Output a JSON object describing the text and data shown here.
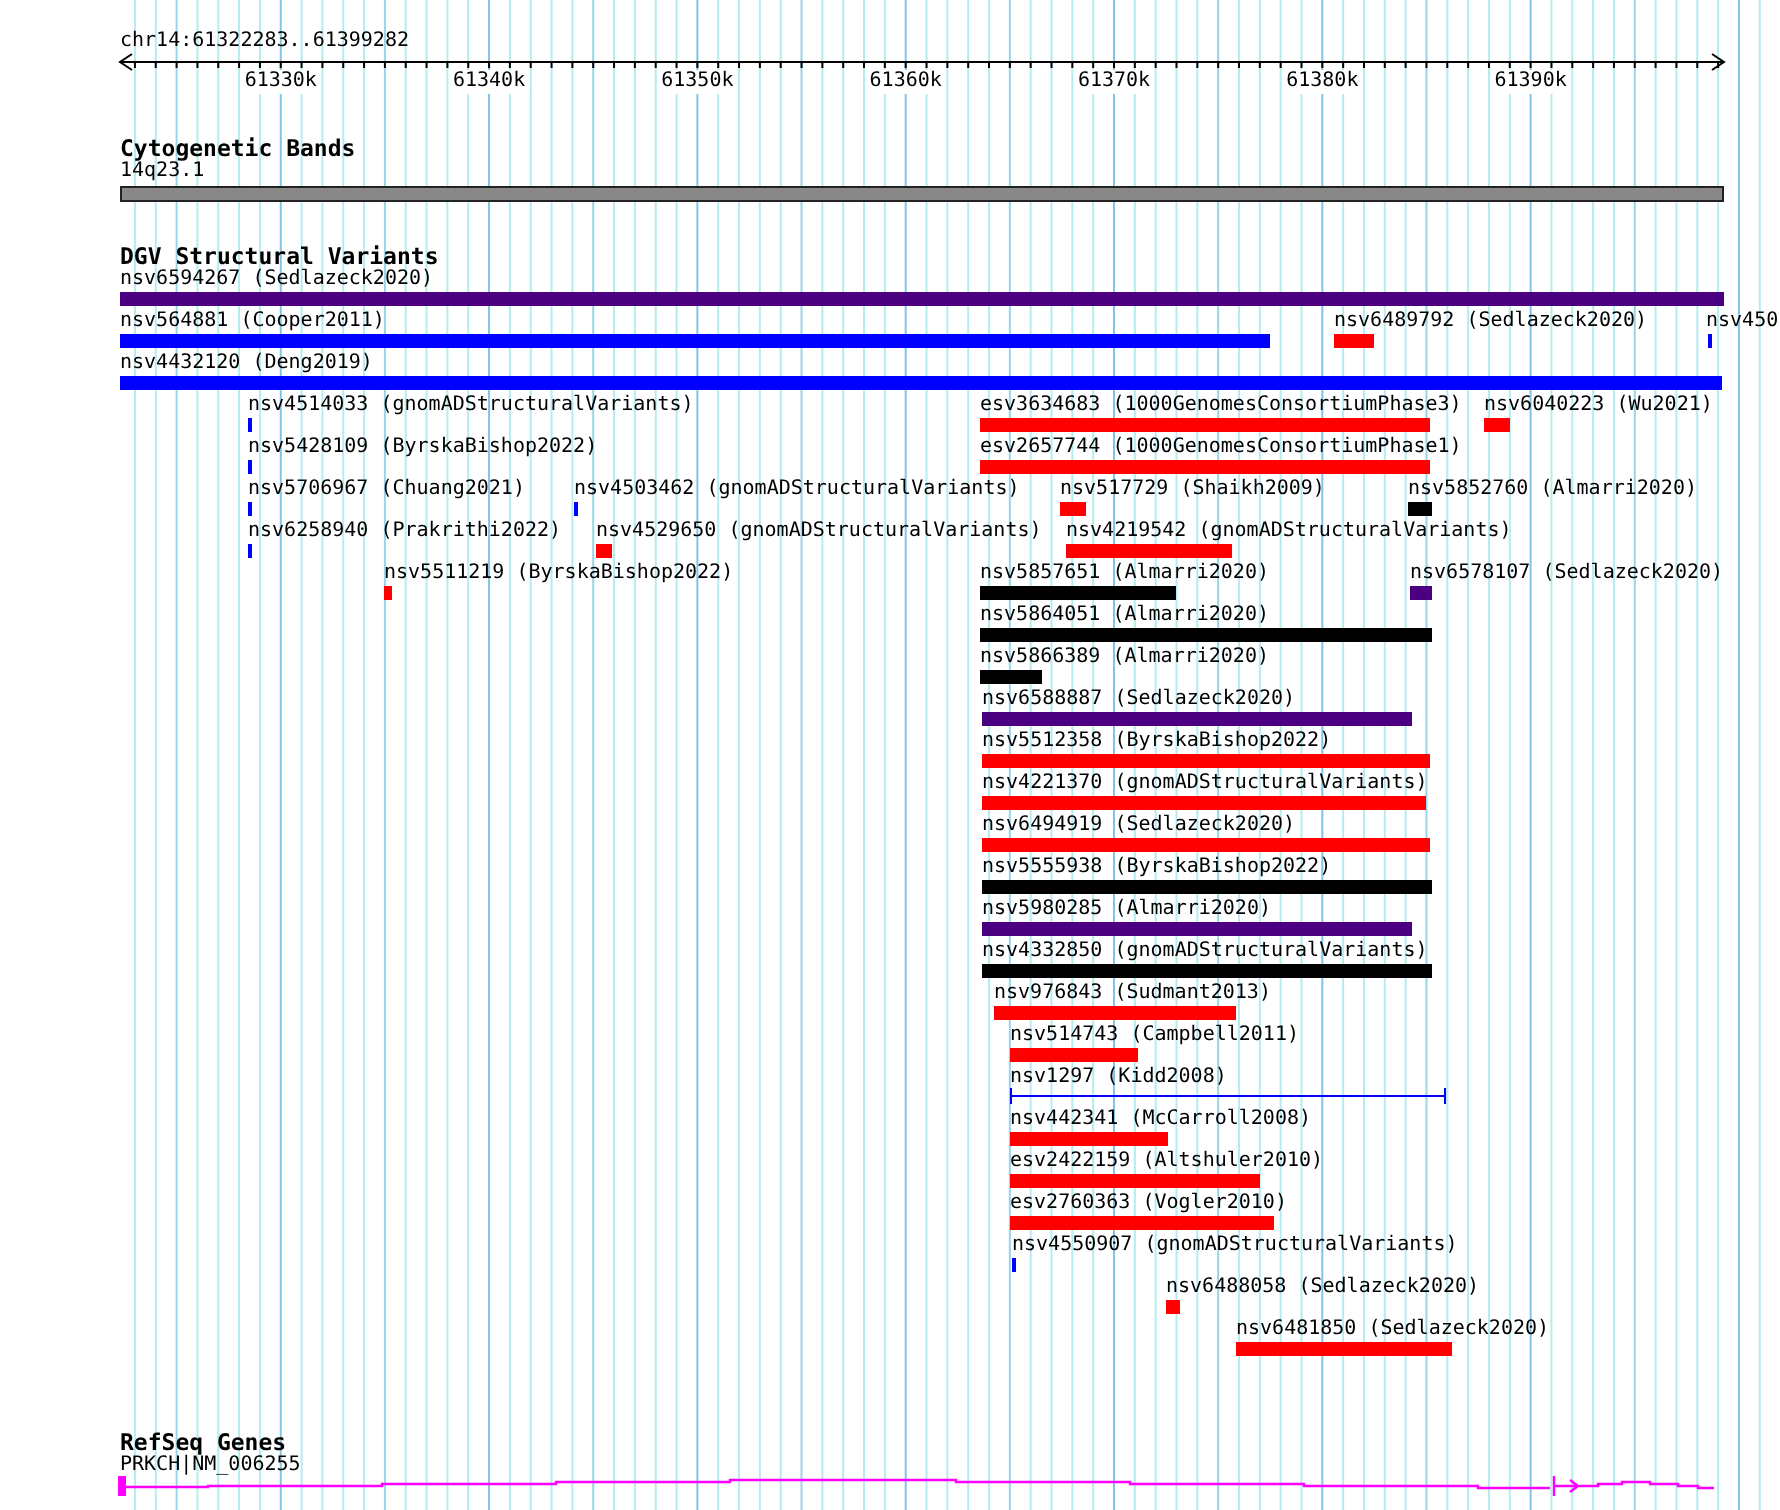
{
  "ruler": {
    "location": "chr14:61322283..61399282",
    "ticks": [
      "61330k",
      "61340k",
      "61350k",
      "61360k",
      "61370k",
      "61380k",
      "61390k"
    ]
  },
  "tracks": [
    {
      "kind": "cytoband",
      "title": "Cytogenetic Bands",
      "features": [
        {
          "label": "14q23.1"
        }
      ]
    },
    {
      "kind": "variants",
      "title": "DGV Structural Variants",
      "features": [
        {
          "label": "nsv6594267 (Sedlazeck2020)",
          "color": "#4b0082",
          "kind": "bar"
        },
        {
          "label": "nsv564881 (Cooper2011)",
          "color": "#0000ff",
          "kind": "bar"
        },
        {
          "label": "nsv6489792 (Sedlazeck2020)",
          "color": "#ff0000",
          "kind": "bar"
        },
        {
          "label": "nsv450",
          "color": "#0000ff",
          "kind": "bar"
        },
        {
          "label": "nsv4432120 (Deng2019)",
          "color": "#0000ff",
          "kind": "bar"
        },
        {
          "label": "nsv4514033 (gnomADStructuralVariants)",
          "color": "#0000ff",
          "kind": "bar"
        },
        {
          "label": "esv3634683 (1000GenomesConsortiumPhase3)",
          "color": "#ff0000",
          "kind": "bar"
        },
        {
          "label": "nsv6040223 (Wu2021)",
          "color": "#ff0000",
          "kind": "bar"
        },
        {
          "label": "nsv5428109 (ByrskaBishop2022)",
          "color": "#0000ff",
          "kind": "bar"
        },
        {
          "label": "esv2657744 (1000GenomesConsortiumPhase1)",
          "color": "#ff0000",
          "kind": "bar"
        },
        {
          "label": "nsv5706967 (Chuang2021)",
          "color": "#0000ff",
          "kind": "bar"
        },
        {
          "label": "nsv4503462 (gnomADStructuralVariants)",
          "color": "#0000ff",
          "kind": "bar"
        },
        {
          "label": "nsv517729 (Shaikh2009)",
          "color": "#ff0000",
          "kind": "bar"
        },
        {
          "label": "nsv5852760 (Almarri2020)",
          "color": "#000000",
          "kind": "bar"
        },
        {
          "label": "nsv6258940 (Prakrithi2022)",
          "color": "#0000ff",
          "kind": "bar"
        },
        {
          "label": "nsv4529650 (gnomADStructuralVariants)",
          "color": "#ff0000",
          "kind": "bar"
        },
        {
          "label": "nsv4219542 (gnomADStructuralVariants)",
          "color": "#ff0000",
          "kind": "bar"
        },
        {
          "label": "nsv5511219 (ByrskaBishop2022)",
          "color": "#ff0000",
          "kind": "bar"
        },
        {
          "label": "nsv5857651 (Almarri2020)",
          "color": "#000000",
          "kind": "bar"
        },
        {
          "label": "nsv6578107 (Sedlazeck2020)",
          "color": "#4b0082",
          "kind": "bar"
        },
        {
          "label": "nsv5864051 (Almarri2020)",
          "color": "#000000",
          "kind": "bar"
        },
        {
          "label": "nsv5866389 (Almarri2020)",
          "color": "#000000",
          "kind": "bar"
        },
        {
          "label": "nsv6588887 (Sedlazeck2020)",
          "color": "#4b0082",
          "kind": "bar"
        },
        {
          "label": "nsv5512358 (ByrskaBishop2022)",
          "color": "#ff0000",
          "kind": "bar"
        },
        {
          "label": "nsv4221370 (gnomADStructuralVariants)",
          "color": "#ff0000",
          "kind": "bar"
        },
        {
          "label": "nsv6494919 (Sedlazeck2020)",
          "color": "#ff0000",
          "kind": "bar"
        },
        {
          "label": "nsv5555938 (ByrskaBishop2022)",
          "color": "#000000",
          "kind": "bar"
        },
        {
          "label": "nsv5980285 (Almarri2020)",
          "color": "#4b0082",
          "kind": "bar"
        },
        {
          "label": "nsv4332850 (gnomADStructuralVariants)",
          "color": "#000000",
          "kind": "bar"
        },
        {
          "label": "nsv976843 (Sudmant2013)",
          "color": "#ff0000",
          "kind": "bar"
        },
        {
          "label": "nsv514743 (Campbell2011)",
          "color": "#ff0000",
          "kind": "bar"
        },
        {
          "label": "nsv1297 (Kidd2008)",
          "color": "#0000ff",
          "kind": "span"
        },
        {
          "label": "nsv442341 (McCarroll2008)",
          "color": "#ff0000",
          "kind": "bar"
        },
        {
          "label": "esv2422159 (Altshuler2010)",
          "color": "#ff0000",
          "kind": "bar"
        },
        {
          "label": "esv2760363 (Vogler2010)",
          "color": "#ff0000",
          "kind": "bar"
        },
        {
          "label": "nsv4550907 (gnomADStructuralVariants)",
          "color": "#0000ff",
          "kind": "bar"
        },
        {
          "label": "nsv6488058 (Sedlazeck2020)",
          "color": "#ff0000",
          "kind": "bar"
        },
        {
          "label": "nsv6481850 (Sedlazeck2020)",
          "color": "#ff0000",
          "kind": "bar"
        }
      ]
    },
    {
      "kind": "genes",
      "title": "RefSeq Genes",
      "features": [
        {
          "label": "PRKCH|NM_006255"
        }
      ]
    }
  ]
}
